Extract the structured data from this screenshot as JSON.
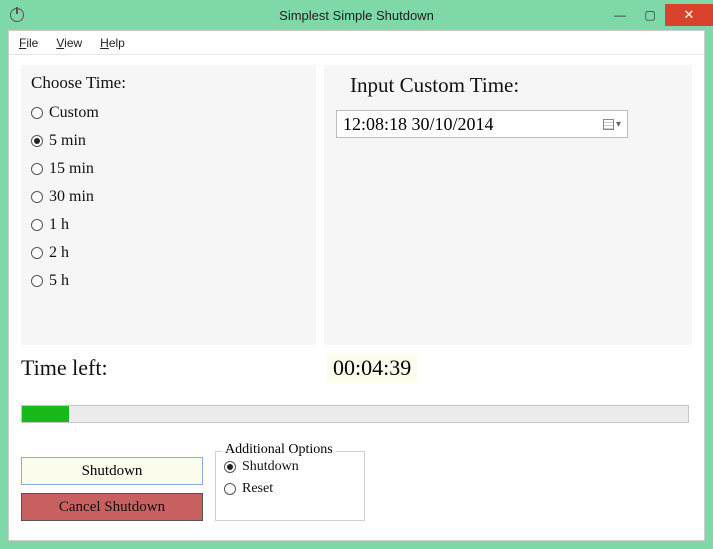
{
  "window": {
    "title": "Simplest Simple Shutdown"
  },
  "menu": {
    "file": "File",
    "view": "View",
    "help": "Help"
  },
  "choose": {
    "label": "Choose Time:",
    "options": {
      "custom": "Custom",
      "m5": "5 min",
      "m15": "15 min",
      "m30": "30 min",
      "h1": "1 h",
      "h2": "2 h",
      "h5": "5 h"
    },
    "selected": "m5"
  },
  "custom": {
    "label": "Input Custom Time:",
    "value": "12:08:18 30/10/2014"
  },
  "timeleft": {
    "label": "Time left:",
    "value": "00:04:39"
  },
  "buttons": {
    "shutdown": "Shutdown",
    "cancel": "Cancel Shutdown"
  },
  "additional": {
    "legend": "Additional Options",
    "shutdown": "Shutdown",
    "reset": "Reset",
    "selected": "shutdown"
  }
}
